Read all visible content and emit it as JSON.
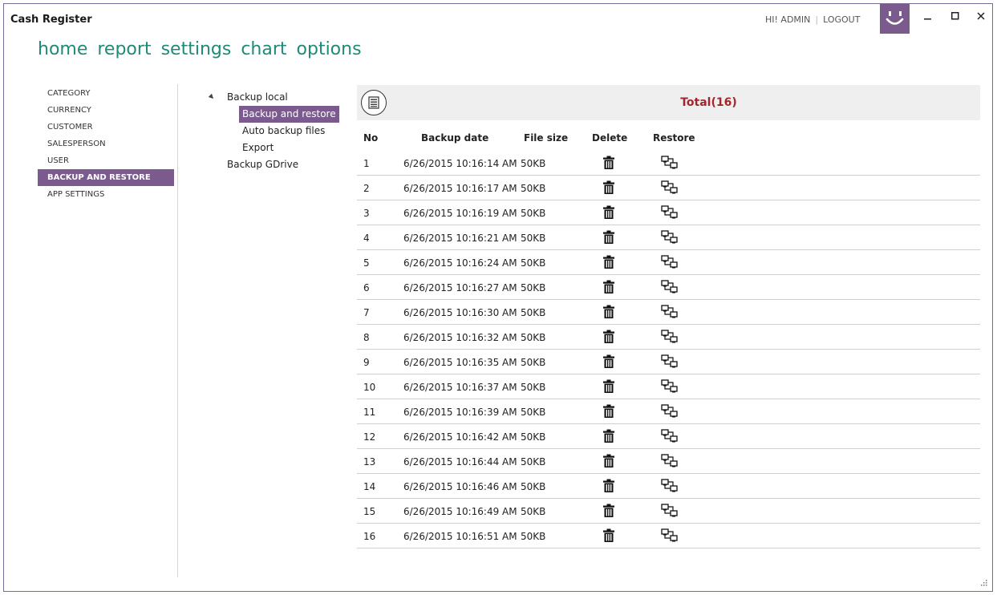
{
  "app": {
    "title": "Cash Register"
  },
  "user": {
    "greeting": "HI! ADMIN",
    "separator": "|",
    "logout": "LOGOUT"
  },
  "nav": [
    "home",
    "report",
    "settings",
    "chart",
    "options"
  ],
  "sidebar": {
    "items": [
      {
        "label": "CATEGORY",
        "active": false
      },
      {
        "label": "CURRENCY",
        "active": false
      },
      {
        "label": "CUSTOMER",
        "active": false
      },
      {
        "label": "SALESPERSON",
        "active": false
      },
      {
        "label": "USER",
        "active": false
      },
      {
        "label": "BACKUP AND RESTORE",
        "active": true
      },
      {
        "label": "APP SETTINGS",
        "active": false
      }
    ]
  },
  "tree": {
    "backup_local": "Backup local",
    "backup_and_restore": "Backup and restore",
    "auto_backup_files": "Auto backup files",
    "export": "Export",
    "backup_gdrive": "Backup GDrive"
  },
  "toolbar": {
    "total": "Total(16)"
  },
  "table": {
    "columns": {
      "no": "No",
      "date": "Backup date",
      "size": "File size",
      "delete": "Delete",
      "restore": "Restore"
    },
    "rows": [
      {
        "no": "1",
        "date": "6/26/2015 10:16:14 AM",
        "size": "50KB"
      },
      {
        "no": "2",
        "date": "6/26/2015 10:16:17 AM",
        "size": "50KB"
      },
      {
        "no": "3",
        "date": "6/26/2015 10:16:19 AM",
        "size": "50KB"
      },
      {
        "no": "4",
        "date": "6/26/2015 10:16:21 AM",
        "size": "50KB"
      },
      {
        "no": "5",
        "date": "6/26/2015 10:16:24 AM",
        "size": "50KB"
      },
      {
        "no": "6",
        "date": "6/26/2015 10:16:27 AM",
        "size": "50KB"
      },
      {
        "no": "7",
        "date": "6/26/2015 10:16:30 AM",
        "size": "50KB"
      },
      {
        "no": "8",
        "date": "6/26/2015 10:16:32 AM",
        "size": "50KB"
      },
      {
        "no": "9",
        "date": "6/26/2015 10:16:35 AM",
        "size": "50KB"
      },
      {
        "no": "10",
        "date": "6/26/2015 10:16:37 AM",
        "size": "50KB"
      },
      {
        "no": "11",
        "date": "6/26/2015 10:16:39 AM",
        "size": "50KB"
      },
      {
        "no": "12",
        "date": "6/26/2015 10:16:42 AM",
        "size": "50KB"
      },
      {
        "no": "13",
        "date": "6/26/2015 10:16:44 AM",
        "size": "50KB"
      },
      {
        "no": "14",
        "date": "6/26/2015 10:16:46 AM",
        "size": "50KB"
      },
      {
        "no": "15",
        "date": "6/26/2015 10:16:49 AM",
        "size": "50KB"
      },
      {
        "no": "16",
        "date": "6/26/2015 10:16:51 AM",
        "size": "50KB"
      }
    ]
  },
  "icons": {
    "avatar": "smiley-icon",
    "list": "list-icon",
    "delete": "trash-icon",
    "restore": "restore-icon"
  },
  "colors": {
    "accent": "#7b5b8e",
    "nav": "#1f8a78",
    "total": "#a4262c"
  }
}
